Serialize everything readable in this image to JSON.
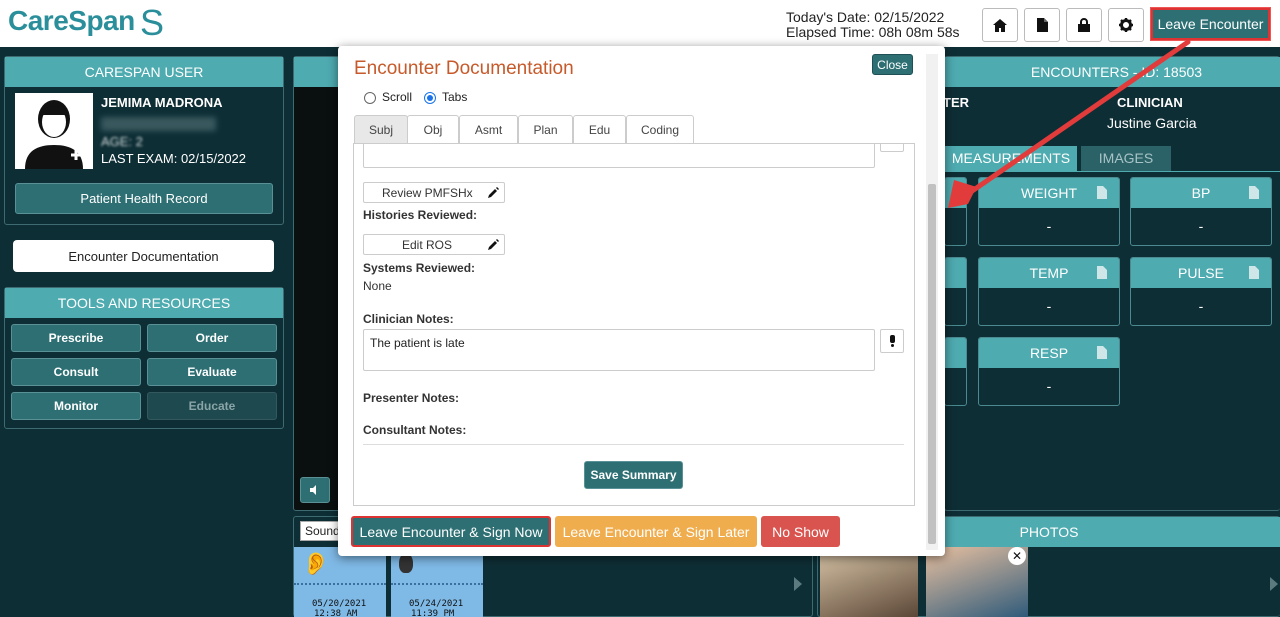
{
  "app": {
    "logo_text": "CareSpan",
    "logo_mark": "S"
  },
  "header": {
    "date_line": "Today's Date: 02/15/2022",
    "elapsed_line": "Elapsed Time: 08h 08m 58s",
    "leave_encounter": "Leave Encounter",
    "icons": [
      "home-icon",
      "document-icon",
      "lock-icon",
      "gear-icon"
    ]
  },
  "user_panel": {
    "title": "CARESPAN USER",
    "name": "JEMIMA MADRONA",
    "dob_blurred": "",
    "age_line": "AGE: 2",
    "last_exam": "LAST EXAM: 02/15/2022",
    "phr_button": "Patient Health Record"
  },
  "encounter_doc_button": "Encounter Documentation",
  "tools": {
    "title": "TOOLS AND RESOURCES",
    "buttons": [
      "Prescribe",
      "Order",
      "Consult",
      "Evaluate",
      "Monitor",
      "Educate"
    ]
  },
  "encounters": {
    "title": "ENCOUNTERS - ID: 18503",
    "presenter_partial": "TER",
    "clinician_label": "CLINICIAN",
    "clinician_name": "Justine Garcia",
    "tab_measurements": "MEASUREMENTS",
    "tab_images": "IMAGES",
    "cards": [
      {
        "title": "WEIGHT",
        "value": "-"
      },
      {
        "title": "BP",
        "value": "-"
      },
      {
        "title": "TEMP",
        "value": "-"
      },
      {
        "title": "PULSE",
        "value": "-"
      },
      {
        "title": "RESP",
        "value": "-"
      }
    ]
  },
  "sounds": {
    "select_label": "Sound",
    "thumbs": [
      {
        "date": "05/20/2021",
        "time": "12:38 AM"
      },
      {
        "date": "05/24/2021",
        "time": "11:39 PM"
      }
    ]
  },
  "photos": {
    "title": "PHOTOS"
  },
  "modal": {
    "title": "Encounter Documentation",
    "close": "Close",
    "radio_scroll": "Scroll",
    "radio_tabs": "Tabs",
    "tabs": [
      "Subj",
      "Obj",
      "Asmt",
      "Plan",
      "Edu",
      "Coding"
    ],
    "review_pmfshx": "Review PMFSHx",
    "histories_reviewed": "Histories Reviewed:",
    "edit_ros": "Edit ROS",
    "systems_reviewed": "Systems Reviewed:",
    "systems_value": "None",
    "clinician_notes_label": "Clinician Notes:",
    "clinician_notes_value": "The patient is late",
    "presenter_notes": "Presenter Notes:",
    "consultant_notes": "Consultant Notes:",
    "save_summary": "Save Summary",
    "btn_sign_now": "Leave Encounter & Sign Now",
    "btn_sign_later": "Leave Encounter & Sign Later",
    "btn_no_show": "No Show"
  },
  "colors": {
    "teal": "#4eabb0",
    "dark_teal": "#2d6f73",
    "bg": "#0e2e35",
    "orange": "#f0ad4e",
    "red": "#d9534f",
    "annotation_red": "#e23b3b"
  }
}
